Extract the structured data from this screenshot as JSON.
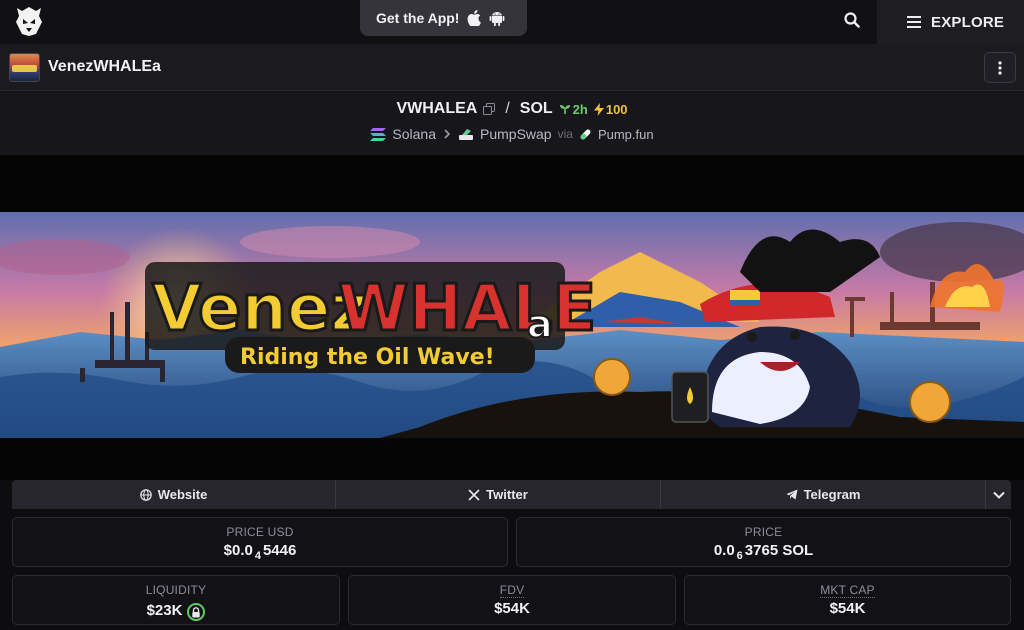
{
  "header": {
    "get_app_label": "Get the App!",
    "explore_label": "EXPLORE"
  },
  "token": {
    "name": "VenezWHALEa"
  },
  "pair": {
    "base": "VWHALEA",
    "quote": "SOL",
    "age": "2h",
    "boosts": "100",
    "chain": "Solana",
    "dex": "PumpSwap",
    "via": "via",
    "launchpad": "Pump.fun"
  },
  "banner": {
    "title_left": "Venez",
    "title_right": "WHALE",
    "title_suffix": "a",
    "tagline": "Riding the Oil Wave!"
  },
  "links": {
    "website": "Website",
    "twitter": "Twitter",
    "telegram": "Telegram"
  },
  "stats": {
    "price_usd_label": "PRICE USD",
    "price_usd_prefix": "$0.0",
    "price_usd_zeros": "4",
    "price_usd_digits": "5446",
    "price_label": "PRICE",
    "price_prefix": "0.0",
    "price_zeros": "6",
    "price_digits": "3765 SOL",
    "liquidity_label": "LIQUIDITY",
    "liquidity_value": "$23K",
    "fdv_label": "FDV",
    "fdv_value": "$54K",
    "mktcap_label": "MKT CAP",
    "mktcap_value": "$54K"
  },
  "colors": {
    "accent_green": "#6ccb6c",
    "boost_yellow": "#f0c040",
    "background": "#0d0d10"
  }
}
